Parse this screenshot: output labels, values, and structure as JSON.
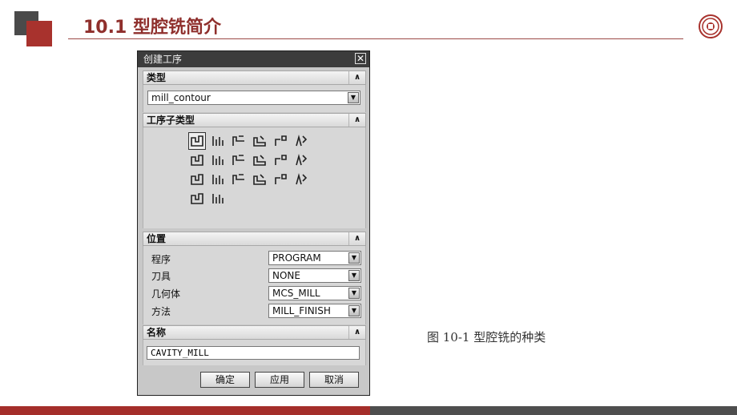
{
  "slide": {
    "title": "10.1   型腔铣简介",
    "caption": "图 10-1   型腔铣的种类"
  },
  "dialog": {
    "title": "创建工序",
    "close_glyph": "✕",
    "sections": {
      "type": {
        "label": "类型",
        "value": "mill_contour"
      },
      "subtype": {
        "label": "工序子类型"
      },
      "location": {
        "label": "位置",
        "fields": [
          {
            "label": "程序",
            "value": "PROGRAM"
          },
          {
            "label": "刀具",
            "value": "NONE"
          },
          {
            "label": "几何体",
            "value": "MCS_MILL"
          },
          {
            "label": "方法",
            "value": "MILL_FINISH"
          }
        ]
      },
      "name": {
        "label": "名称",
        "value": "CAVITY_MILL"
      }
    },
    "collapse_glyph": "∧",
    "dropdown_glyph": "▼",
    "buttons": {
      "ok": "确定",
      "apply": "应用",
      "cancel": "取消"
    }
  },
  "icons": [
    [
      "cavity-mill-icon",
      "plunge-mill-icon",
      "corner-rough-icon",
      "rest-mill-icon",
      "zlevel-profile-icon",
      "zlevel-corner-icon"
    ],
    [
      "fixed-contour-icon",
      "contour-area-icon",
      "contour-surface-icon",
      "streamline-icon",
      "contour-area-nonsteep-icon",
      "contour-area-dir-steep-icon"
    ],
    [
      "flowcut-single-icon",
      "flowcut-multiple-icon",
      "flowcut-ref-tool-icon",
      "solid-profile-3d-icon",
      "contour-profile-icon",
      "contour-text-icon"
    ],
    [
      "mill-user-icon",
      "mill-control-icon"
    ]
  ],
  "colors": {
    "accent_red": "#a8322d",
    "titlebar": "#3c3c3c",
    "footer_gray": "#4e4e4e"
  }
}
